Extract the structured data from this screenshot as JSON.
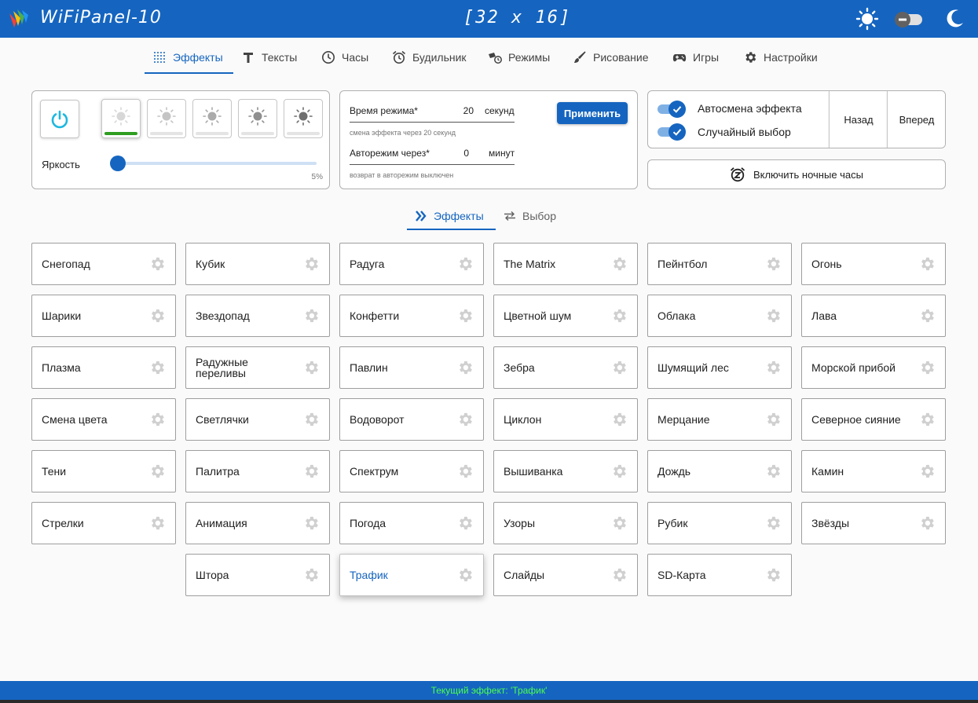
{
  "header": {
    "app_title": "WiFiPanel-10",
    "matrix_size": "[32 x 16]",
    "icons": [
      "brightness-icon",
      "toggle-icon",
      "night-mode-icon"
    ]
  },
  "nav": {
    "tabs": [
      {
        "label": "Эффекты",
        "icon": "effects-icon",
        "active": true
      },
      {
        "label": "Тексты",
        "icon": "text-icon"
      },
      {
        "label": "Часы",
        "icon": "clock-icon"
      },
      {
        "label": "Будильник",
        "icon": "alarm-icon"
      },
      {
        "label": "Режимы",
        "icon": "modes-icon"
      },
      {
        "label": "Рисование",
        "icon": "brush-icon"
      },
      {
        "label": "Игры",
        "icon": "gamepad-icon"
      },
      {
        "label": "Настройки",
        "icon": "settings-icon"
      }
    ]
  },
  "brightness": {
    "label": "Яркость",
    "value_label": "5%",
    "value_fraction": 0.05,
    "preset_count": 5,
    "active_preset": 0
  },
  "mode": {
    "time_label": "Время режима*",
    "time_value": "20",
    "time_unit": "секунд",
    "time_hint": "смена эффекта через 20 секунд",
    "auto_label": "Авторежим через*",
    "auto_value": "0",
    "auto_unit": "минут",
    "auto_hint": "возврат в авторежим выключен",
    "apply_label": "Применить"
  },
  "switches": {
    "auto_change_label": "Автосмена эффекта",
    "random_label": "Случайный выбор",
    "back_label": "Назад",
    "forward_label": "Вперед",
    "night_clock_label": "Включить ночные часы"
  },
  "subtabs": {
    "effects_label": "Эффекты",
    "select_label": "Выбор"
  },
  "effects": [
    [
      "Снегопад",
      "Кубик",
      "Радуга",
      "The Matrix",
      "Пейнтбол",
      "Огонь"
    ],
    [
      "Шарики",
      "Звездопад",
      "Конфетти",
      "Цветной шум",
      "Облака",
      "Лава"
    ],
    [
      "Плазма",
      "Радужные переливы",
      "Павлин",
      "Зебра",
      "Шумящий лес",
      "Морской прибой"
    ],
    [
      "Смена цвета",
      "Светлячки",
      "Водоворот",
      "Циклон",
      "Мерцание",
      "Северное сияние"
    ],
    [
      "Тени",
      "Палитра",
      "Спектрум",
      "Вышиванка",
      "Дождь",
      "Камин"
    ],
    [
      "Стрелки",
      "Анимация",
      "Погода",
      "Узоры",
      "Рубик",
      "Звёзды"
    ],
    [
      null,
      "Штора",
      "Трафик",
      "Слайды",
      "SD-Карта",
      null
    ]
  ],
  "current_effect": "Трафик",
  "status": "Текущий эффект: 'Трафик'",
  "colors": {
    "primary": "#1565c0",
    "status_text": "#4cff4c",
    "active_bar": "#2e9d20"
  }
}
